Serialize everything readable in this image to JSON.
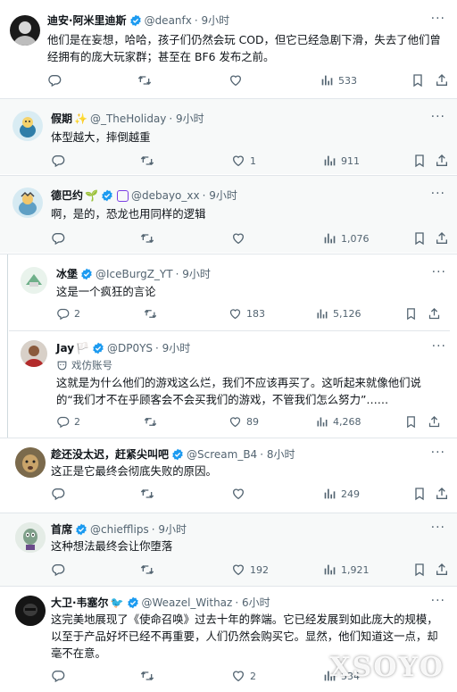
{
  "tweets": [
    {
      "name": "迪安·阿米里迪斯",
      "handle": "@deanfx",
      "time": "· 9小时",
      "text": "他们是在妄想，哈哈，孩子们仍然会玩 COD，但它已经急剧下滑，失去了他们曾经拥有的庞大玩家群；甚至在 BF6 发布之前。",
      "replies": "",
      "retweets": "",
      "likes": "",
      "views": "533"
    },
    {
      "name": "假期",
      "handle": "@_TheHoliday",
      "time": "· 9小时",
      "text": "体型越大，摔倒越重",
      "replies": "",
      "retweets": "",
      "likes": "1",
      "views": "911"
    },
    {
      "name": "德巴约",
      "handle": "@debayo_xx",
      "time": "· 9小时",
      "text": "啊，是的，恐龙也用同样的逻辑",
      "replies": "",
      "retweets": "",
      "likes": "",
      "views": "1,076"
    },
    {
      "name": "冰堡",
      "handle": "@IceBurgZ_YT",
      "time": "· 9小时",
      "text": "这是一个疯狂的言论",
      "replies": "2",
      "retweets": "",
      "likes": "183",
      "views": "5,126"
    },
    {
      "name": "Jay",
      "handle": "@DP0YS",
      "time": "· 9小时",
      "role": "戏仿账号",
      "text": "这就是为什么他们的游戏这么烂，我们不应该再买了。这听起来就像他们说的“我们才不在乎顾客会不会买我们的游戏，不管我们怎么努力”……",
      "replies": "2",
      "retweets": "",
      "likes": "89",
      "views": "4,268"
    },
    {
      "name": "趁还没太迟，赶紧尖叫吧",
      "handle": "@Scream_B4",
      "time": "· 8小时",
      "text": "这正是它最终会彻底失败的原因。",
      "replies": "",
      "retweets": "",
      "likes": "",
      "views": "249"
    },
    {
      "name": "首席",
      "handle": "@chiefflips",
      "time": "· 9小时",
      "text": "这种想法最终会让你堕落",
      "replies": "",
      "retweets": "",
      "likes": "192",
      "views": "1,921"
    },
    {
      "name": "大卫·韦塞尔",
      "handle": "@Weazel_Withaz",
      "time": "· 6小时",
      "text": "这完美地展现了《使命召唤》过去十年的弊端。它已经发展到如此庞大的规模，以至于产品好坏已经不再重要，人们仍然会购买它。显然，他们知道这一点，却毫不在意。",
      "replies": "",
      "retweets": "",
      "likes": "2",
      "views": "534"
    }
  ],
  "watermark": "XSOYO",
  "colors": {
    "verified": "#1d9bf0",
    "muted": "#536471",
    "text": "#0f1419"
  }
}
